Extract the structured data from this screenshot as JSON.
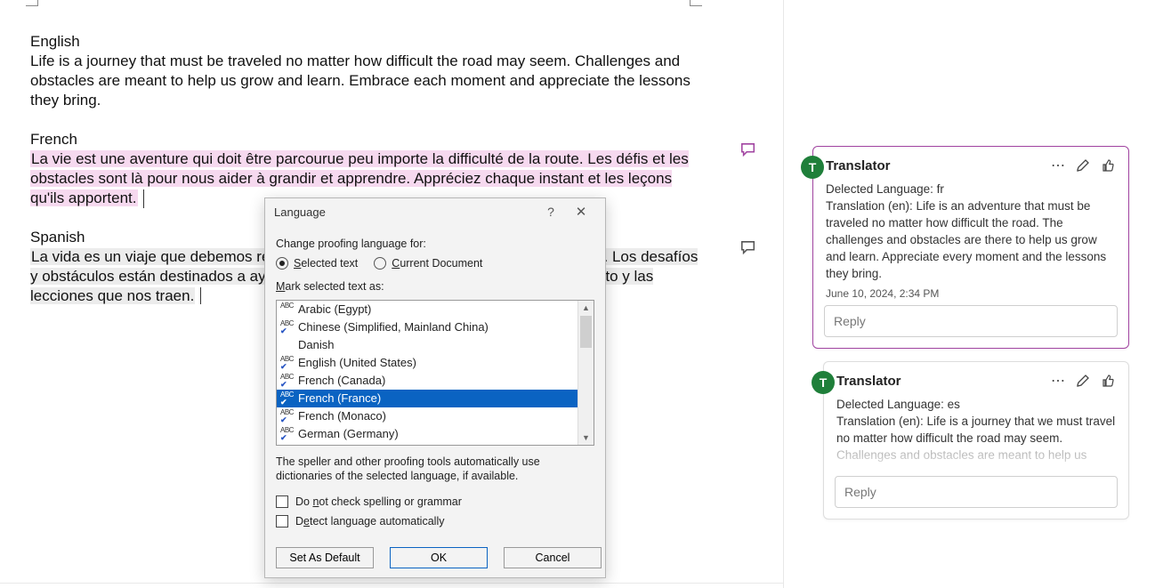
{
  "document": {
    "english_heading": "English",
    "english_body": "Life is a journey that must be traveled no matter how difficult the road may seem. Challenges and obstacles are meant to help us grow and learn. Embrace each moment and appreciate the lessons they bring.",
    "french_heading": "French",
    "french_body": "La vie est une aventure qui doit être parcourue peu importe la difficulté de la route. Les défis et les obstacles sont là pour nous aider à grandir et apprendre. Appréciez chaque instant et les leçons qu'ils apportent.",
    "spanish_heading": "Spanish",
    "spanish_body": "La vida es un viaje que debemos recorrer sin importar lo difícil que parezca el camino. Los desafíos y obstáculos están destinados a ayudarnos a crecer y aprender. Aprecia cada momento y las lecciones que nos traen."
  },
  "dialog": {
    "title": "Language",
    "help_char": "?",
    "close_char": "✕",
    "change_label": "Change proofing language for:",
    "radio_selected_prefix": "S",
    "radio_selected_rest": "elected text",
    "radio_document_prefix": "C",
    "radio_document_rest": "urrent Document",
    "mark_label_prefix": "M",
    "mark_label_rest": "ark selected text as:",
    "languages": [
      {
        "name": "Arabic (Egypt)",
        "icon": "abc"
      },
      {
        "name": "Chinese (Simplified, Mainland China)",
        "icon": "abc-check"
      },
      {
        "name": "Danish",
        "icon": "none"
      },
      {
        "name": "English (United States)",
        "icon": "abc-check"
      },
      {
        "name": "French (Canada)",
        "icon": "abc-check"
      },
      {
        "name": "French (France)",
        "icon": "abc-check",
        "selected": true
      },
      {
        "name": "French (Monaco)",
        "icon": "abc-check"
      },
      {
        "name": "German (Germany)",
        "icon": "abc-check"
      }
    ],
    "note": "The speller and other proofing tools automatically use dictionaries of the selected language, if available.",
    "chk1_pre": "Do ",
    "chk1_u": "n",
    "chk1_post": "ot check spelling or grammar",
    "chk2_pre": "D",
    "chk2_u": "e",
    "chk2_post": "tect language automatically",
    "btn_default": "Set As Default",
    "btn_ok": "OK",
    "btn_cancel": "Cancel"
  },
  "comments": {
    "avatar_letter": "T",
    "c1": {
      "author": "Translator",
      "line1": "Delected Language: fr",
      "line2": "Translation (en): Life is an adventure that must be traveled no matter how difficult the road. The challenges and obstacles are there to help us grow and learn. Appreciate every moment and the lessons they bring.",
      "date": "June 10, 2024, 2:34 PM",
      "reply": "Reply"
    },
    "c2": {
      "author": "Translator",
      "line1": "Delected Language: es",
      "line2a": "Translation (en): Life is a journey that we must travel no matter how difficult the road may seem.",
      "line2b": "Challenges and obstacles are meant to help us",
      "reply": "Reply"
    }
  }
}
